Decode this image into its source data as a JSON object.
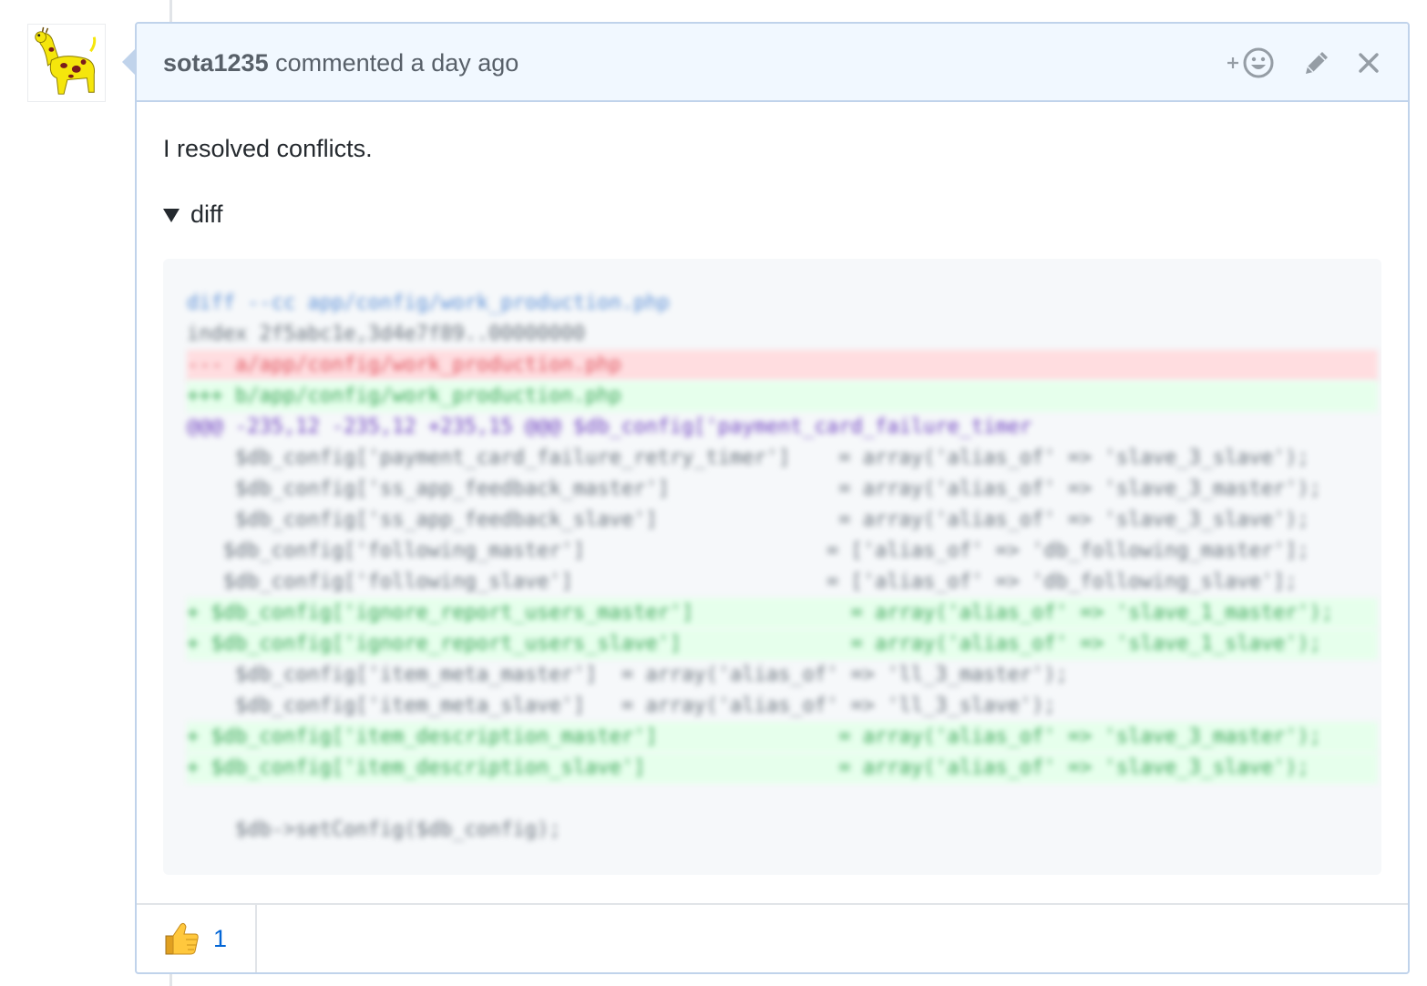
{
  "comment": {
    "author": "sota1235",
    "action_text": "commented a day ago",
    "body": "I resolved conflicts.",
    "details_summary": "diff",
    "actions": {
      "reaction_add_icon": "smiley-plus-icon",
      "edit_icon": "pencil-icon",
      "delete_icon": "x-icon"
    }
  },
  "diff_lines": [
    {
      "kind": "meta",
      "text": "diff --cc app/config/work_production.php"
    },
    {
      "kind": "index",
      "text": "index 2f5abc1e,3d4e7f89..00000000"
    },
    {
      "kind": "del",
      "text": "--- a/app/config/work_production.php"
    },
    {
      "kind": "add",
      "text": "+++ b/app/config/work_production.php"
    },
    {
      "kind": "hunk",
      "text": "@@@ -235,12 -235,12 +235,15 @@@ $db_config['payment_card_failure_timer"
    },
    {
      "kind": "ctx",
      "text": "    $db_config['payment_card_failure_retry_timer']    = array('alias_of' => 'slave_3_slave');"
    },
    {
      "kind": "ctx",
      "text": "    $db_config['ss_app_feedback_master']              = array('alias_of' => 'slave_3_master');"
    },
    {
      "kind": "ctx",
      "text": "    $db_config['ss_app_feedback_slave']               = array('alias_of' => 'slave_3_slave');"
    },
    {
      "kind": "ctx",
      "text": "   $db_config['following_master']                    = ['alias_of' => 'db_following_master'];"
    },
    {
      "kind": "ctx",
      "text": "   $db_config['following_slave']                     = ['alias_of' => 'db_following_slave'];"
    },
    {
      "kind": "add",
      "text": "+ $db_config['ignore_report_users_master']             = array('alias_of' => 'slave_1_master');"
    },
    {
      "kind": "add",
      "text": "+ $db_config['ignore_report_users_slave']              = array('alias_of' => 'slave_1_slave');"
    },
    {
      "kind": "ctx",
      "text": "    $db_config['item_meta_master']  = array('alias_of' => 'll_3_master');"
    },
    {
      "kind": "ctx",
      "text": "    $db_config['item_meta_slave']   = array('alias_of' => 'll_3_slave');"
    },
    {
      "kind": "add",
      "text": "+ $db_config['item_description_master']               = array('alias_of' => 'slave_3_master');"
    },
    {
      "kind": "add",
      "text": "+ $db_config['item_description_slave']                = array('alias_of' => 'slave_3_slave');"
    },
    {
      "kind": "blank",
      "text": ""
    },
    {
      "kind": "ctx",
      "text": "    $db->setConfig($db_config);"
    }
  ],
  "reactions": [
    {
      "icon": "thumbs-up-icon",
      "count": "1"
    }
  ]
}
